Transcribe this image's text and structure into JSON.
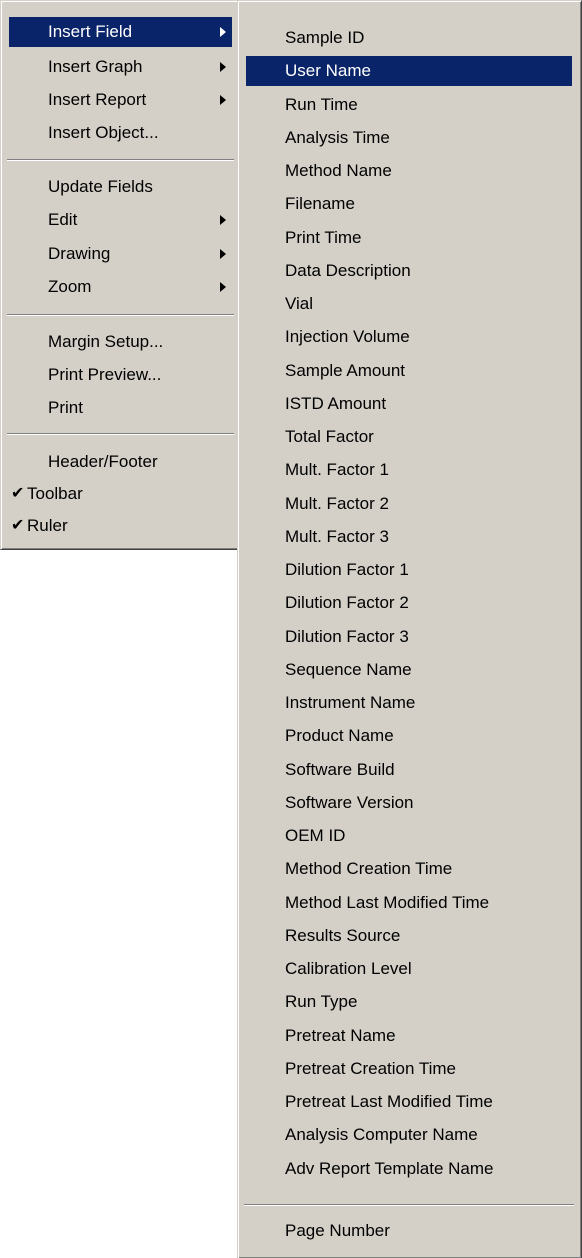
{
  "main_menu": {
    "insert_field": "Insert Field",
    "insert_graph": "Insert Graph",
    "insert_report": "Insert Report",
    "insert_object": "Insert Object...",
    "update_fields": "Update Fields",
    "edit": "Edit",
    "drawing": "Drawing",
    "zoom": "Zoom",
    "margin_setup": "Margin Setup...",
    "print_preview": "Print Preview...",
    "print": "Print",
    "header_footer": "Header/Footer",
    "toolbar": "Toolbar",
    "ruler": "Ruler",
    "check_mark": "✔"
  },
  "field_menu": {
    "items": [
      "Sample ID",
      "User Name",
      "Run Time",
      "Analysis Time",
      "Method Name",
      "Filename",
      "Print Time",
      "Data Description",
      "Vial",
      "Injection Volume",
      "Sample Amount",
      "ISTD Amount",
      "Total Factor",
      "Mult. Factor 1",
      "Mult. Factor 2",
      "Mult. Factor 3",
      "Dilution Factor 1",
      "Dilution Factor 2",
      "Dilution Factor 3",
      "Sequence Name",
      "Instrument Name",
      "Product Name",
      "Software Build",
      "Software Version",
      "OEM ID",
      "Method Creation Time",
      "Method Last Modified Time",
      "Results Source",
      "Calibration Level",
      "Run Type",
      "Pretreat Name",
      "Pretreat Creation Time",
      "Pretreat Last Modified Time",
      "Analysis Computer Name",
      "Adv Report Template Name"
    ],
    "page_number": "Page Number"
  },
  "colors": {
    "menu_bg": "#d4d0c8",
    "highlight_bg": "#0a246a",
    "highlight_text": "#ffffff"
  }
}
